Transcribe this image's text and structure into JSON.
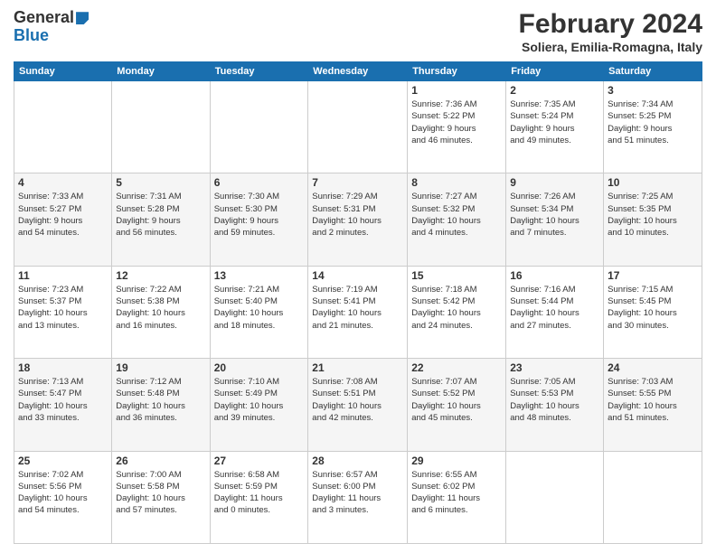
{
  "header": {
    "logo_general": "General",
    "logo_blue": "Blue",
    "month_title": "February 2024",
    "location": "Soliera, Emilia-Romagna, Italy"
  },
  "days_of_week": [
    "Sunday",
    "Monday",
    "Tuesday",
    "Wednesday",
    "Thursday",
    "Friday",
    "Saturday"
  ],
  "weeks": [
    [
      {
        "day": "",
        "info": ""
      },
      {
        "day": "",
        "info": ""
      },
      {
        "day": "",
        "info": ""
      },
      {
        "day": "",
        "info": ""
      },
      {
        "day": "1",
        "info": "Sunrise: 7:36 AM\nSunset: 5:22 PM\nDaylight: 9 hours\nand 46 minutes."
      },
      {
        "day": "2",
        "info": "Sunrise: 7:35 AM\nSunset: 5:24 PM\nDaylight: 9 hours\nand 49 minutes."
      },
      {
        "day": "3",
        "info": "Sunrise: 7:34 AM\nSunset: 5:25 PM\nDaylight: 9 hours\nand 51 minutes."
      }
    ],
    [
      {
        "day": "4",
        "info": "Sunrise: 7:33 AM\nSunset: 5:27 PM\nDaylight: 9 hours\nand 54 minutes."
      },
      {
        "day": "5",
        "info": "Sunrise: 7:31 AM\nSunset: 5:28 PM\nDaylight: 9 hours\nand 56 minutes."
      },
      {
        "day": "6",
        "info": "Sunrise: 7:30 AM\nSunset: 5:30 PM\nDaylight: 9 hours\nand 59 minutes."
      },
      {
        "day": "7",
        "info": "Sunrise: 7:29 AM\nSunset: 5:31 PM\nDaylight: 10 hours\nand 2 minutes."
      },
      {
        "day": "8",
        "info": "Sunrise: 7:27 AM\nSunset: 5:32 PM\nDaylight: 10 hours\nand 4 minutes."
      },
      {
        "day": "9",
        "info": "Sunrise: 7:26 AM\nSunset: 5:34 PM\nDaylight: 10 hours\nand 7 minutes."
      },
      {
        "day": "10",
        "info": "Sunrise: 7:25 AM\nSunset: 5:35 PM\nDaylight: 10 hours\nand 10 minutes."
      }
    ],
    [
      {
        "day": "11",
        "info": "Sunrise: 7:23 AM\nSunset: 5:37 PM\nDaylight: 10 hours\nand 13 minutes."
      },
      {
        "day": "12",
        "info": "Sunrise: 7:22 AM\nSunset: 5:38 PM\nDaylight: 10 hours\nand 16 minutes."
      },
      {
        "day": "13",
        "info": "Sunrise: 7:21 AM\nSunset: 5:40 PM\nDaylight: 10 hours\nand 18 minutes."
      },
      {
        "day": "14",
        "info": "Sunrise: 7:19 AM\nSunset: 5:41 PM\nDaylight: 10 hours\nand 21 minutes."
      },
      {
        "day": "15",
        "info": "Sunrise: 7:18 AM\nSunset: 5:42 PM\nDaylight: 10 hours\nand 24 minutes."
      },
      {
        "day": "16",
        "info": "Sunrise: 7:16 AM\nSunset: 5:44 PM\nDaylight: 10 hours\nand 27 minutes."
      },
      {
        "day": "17",
        "info": "Sunrise: 7:15 AM\nSunset: 5:45 PM\nDaylight: 10 hours\nand 30 minutes."
      }
    ],
    [
      {
        "day": "18",
        "info": "Sunrise: 7:13 AM\nSunset: 5:47 PM\nDaylight: 10 hours\nand 33 minutes."
      },
      {
        "day": "19",
        "info": "Sunrise: 7:12 AM\nSunset: 5:48 PM\nDaylight: 10 hours\nand 36 minutes."
      },
      {
        "day": "20",
        "info": "Sunrise: 7:10 AM\nSunset: 5:49 PM\nDaylight: 10 hours\nand 39 minutes."
      },
      {
        "day": "21",
        "info": "Sunrise: 7:08 AM\nSunset: 5:51 PM\nDaylight: 10 hours\nand 42 minutes."
      },
      {
        "day": "22",
        "info": "Sunrise: 7:07 AM\nSunset: 5:52 PM\nDaylight: 10 hours\nand 45 minutes."
      },
      {
        "day": "23",
        "info": "Sunrise: 7:05 AM\nSunset: 5:53 PM\nDaylight: 10 hours\nand 48 minutes."
      },
      {
        "day": "24",
        "info": "Sunrise: 7:03 AM\nSunset: 5:55 PM\nDaylight: 10 hours\nand 51 minutes."
      }
    ],
    [
      {
        "day": "25",
        "info": "Sunrise: 7:02 AM\nSunset: 5:56 PM\nDaylight: 10 hours\nand 54 minutes."
      },
      {
        "day": "26",
        "info": "Sunrise: 7:00 AM\nSunset: 5:58 PM\nDaylight: 10 hours\nand 57 minutes."
      },
      {
        "day": "27",
        "info": "Sunrise: 6:58 AM\nSunset: 5:59 PM\nDaylight: 11 hours\nand 0 minutes."
      },
      {
        "day": "28",
        "info": "Sunrise: 6:57 AM\nSunset: 6:00 PM\nDaylight: 11 hours\nand 3 minutes."
      },
      {
        "day": "29",
        "info": "Sunrise: 6:55 AM\nSunset: 6:02 PM\nDaylight: 11 hours\nand 6 minutes."
      },
      {
        "day": "",
        "info": ""
      },
      {
        "day": "",
        "info": ""
      }
    ]
  ]
}
